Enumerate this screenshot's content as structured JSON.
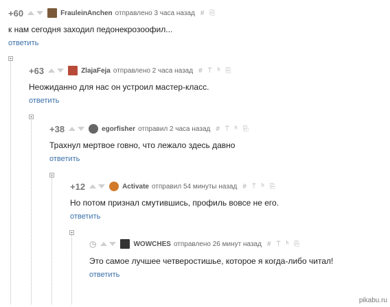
{
  "comments": [
    {
      "score": "+60",
      "user": "FrauleinAnchen",
      "meta": "отправлено 3 часа назад",
      "text": "к нам сегодня заходил педонекрозоофил...",
      "reply": "ответить",
      "avatar_color": "#7a5a3a"
    },
    {
      "score": "+63",
      "user": "ZlajaFeja",
      "meta": "отправлено 2 часа назад",
      "text": "Неожиданно для нас он устроил мастер-класс.",
      "reply": "ответить",
      "avatar_color": "#b84a3a"
    },
    {
      "score": "+38",
      "user": "egorfisher",
      "meta": "отправил 2 часа назад",
      "text": "Трахнул мертвое говно, что лежало здесь давно",
      "reply": "ответить",
      "avatar_color": "#666666"
    },
    {
      "score": "+12",
      "user": "Activate",
      "meta": "отправил 54 минуты назад",
      "text": "Но потом признал смутившись, профиль вовсе не его.",
      "reply": "ответить",
      "avatar_color": "#d07a2a"
    },
    {
      "score": "",
      "user": "WOWCHES",
      "meta": "отправлено 26 минут назад",
      "text": "Это самое лучшее четверостишье, которое я когда-либо читал!",
      "reply": "ответить",
      "avatar_color": "#333333"
    }
  ],
  "tools": {
    "hash": "#",
    "up": "⍑",
    "link": "ʰ",
    "save": "⎘"
  },
  "watermark": "pikabu.ru"
}
